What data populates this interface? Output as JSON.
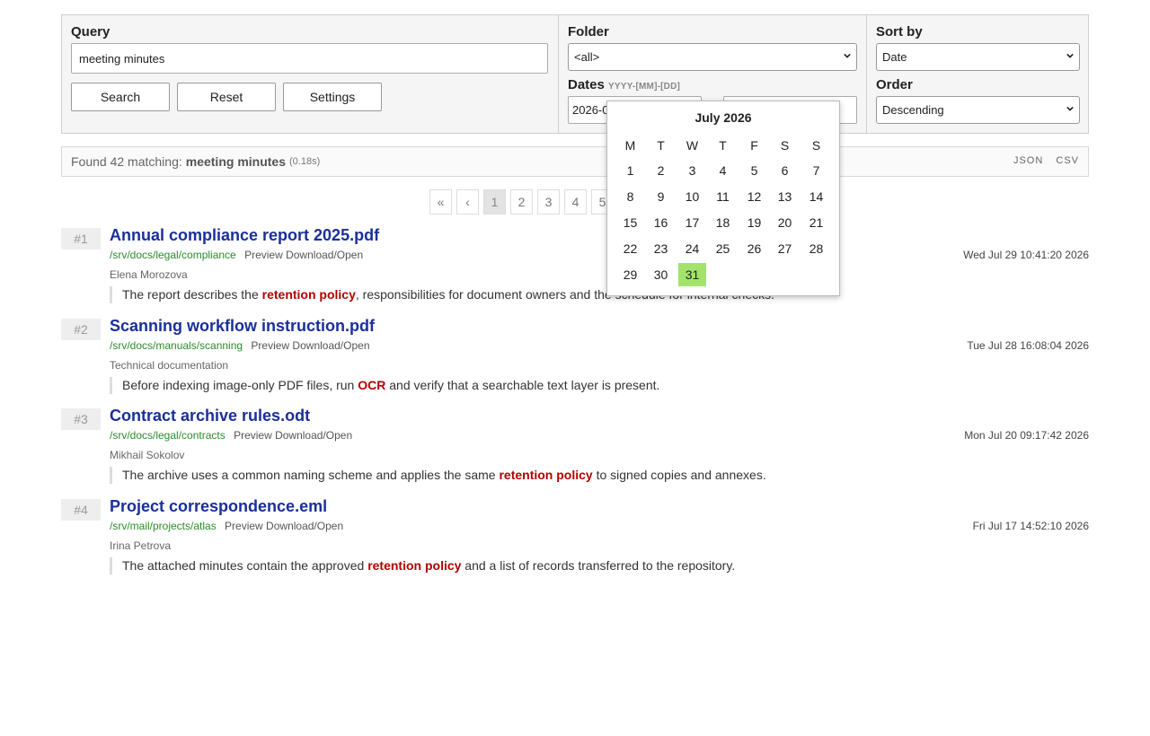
{
  "search": {
    "query_label": "Query",
    "query_value": "meeting minutes",
    "buttons": [
      "Search",
      "Reset",
      "Settings"
    ],
    "folder_label": "Folder",
    "folder_value": "<all>",
    "dates_label": "Dates",
    "dates_hint": "YYYY-[MM]-[DD]",
    "date_from_value": "2026-0",
    "date_to_value": "",
    "sort_label": "Sort by",
    "sort_value": "Date",
    "order_label": "Order",
    "order_value": "Descending"
  },
  "status": {
    "found_text": "Found 42 matching:",
    "query": "meeting minutes",
    "time": "(0.18s)",
    "exports": [
      "JSON",
      "CSV"
    ]
  },
  "pager": {
    "first": "«",
    "prev": "‹",
    "pages": [
      "1",
      "2",
      "3",
      "4",
      "5"
    ],
    "active_page": 1
  },
  "calendar": {
    "title": "July 2026",
    "weekdays": [
      "M",
      "T",
      "W",
      "T",
      "F",
      "S",
      "S"
    ],
    "days": [
      "1",
      "2",
      "3",
      "4",
      "5",
      "6",
      "7",
      "8",
      "9",
      "10",
      "11",
      "12",
      "13",
      "14",
      "15",
      "16",
      "17",
      "18",
      "19",
      "20",
      "21",
      "22",
      "23",
      "24",
      "25",
      "26",
      "27",
      "28",
      "29",
      "30",
      "31"
    ],
    "selected_day": "31",
    "selected_color": "#a4e36a"
  },
  "results": [
    {
      "rank": "#1",
      "title": "Annual compliance report 2025.pdf",
      "path": "/srv/docs/legal/compliance",
      "links": "Preview Download/Open",
      "date": "Wed Jul 29 10:41:20 2026",
      "author": "Elena Morozova",
      "snippet": [
        {
          "t": "The report describes the "
        },
        {
          "t": "retention policy",
          "hl": true
        },
        {
          "t": ", responsibilities for document owners and the schedule for internal checks."
        }
      ]
    },
    {
      "rank": "#2",
      "title": "Scanning workflow instruction.pdf",
      "path": "/srv/docs/manuals/scanning",
      "links": "Preview Download/Open",
      "date": "Tue Jul 28 16:08:04 2026",
      "author": "Technical documentation",
      "snippet": [
        {
          "t": "Before indexing image-only PDF files, run "
        },
        {
          "t": "OCR",
          "hl": true
        },
        {
          "t": " and verify that a searchable text layer is present."
        }
      ]
    },
    {
      "rank": "#3",
      "title": "Contract archive rules.odt",
      "path": "/srv/docs/legal/contracts",
      "links": "Preview Download/Open",
      "date": "Mon Jul 20 09:17:42 2026",
      "author": "Mikhail Sokolov",
      "snippet": [
        {
          "t": "The archive uses a common naming scheme and applies the same "
        },
        {
          "t": "retention policy",
          "hl": true
        },
        {
          "t": " to signed copies and annexes."
        }
      ]
    },
    {
      "rank": "#4",
      "title": "Project correspondence.eml",
      "path": "/srv/mail/projects/atlas",
      "links": "Preview Download/Open",
      "date": "Fri Jul 17 14:52:10 2026",
      "author": "Irina Petrova",
      "snippet": [
        {
          "t": "The attached minutes contain the approved "
        },
        {
          "t": "retention policy",
          "hl": true
        },
        {
          "t": " and a list of records transferred to the repository."
        }
      ]
    }
  ]
}
